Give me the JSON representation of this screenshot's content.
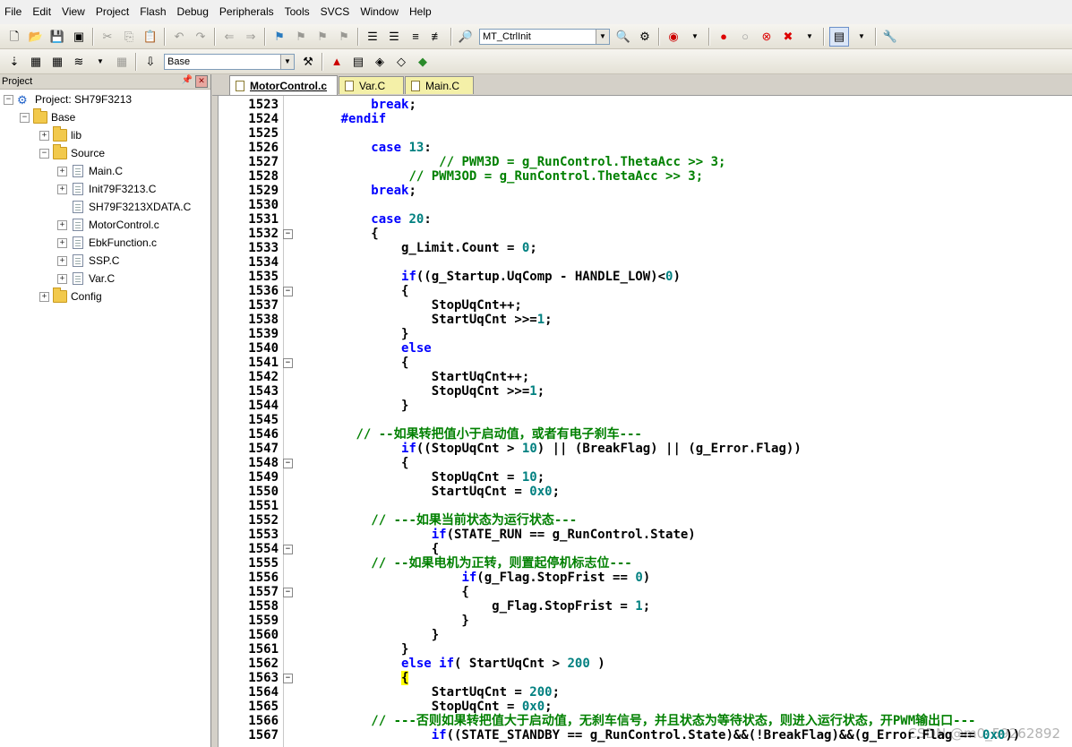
{
  "menu": [
    "File",
    "Edit",
    "View",
    "Project",
    "Flash",
    "Debug",
    "Peripherals",
    "Tools",
    "SVCS",
    "Window",
    "Help"
  ],
  "toolbar1": {
    "function_combo": "MT_CtrlInit"
  },
  "toolbar2": {
    "target_combo": "Base"
  },
  "project_panel": {
    "title": "Project",
    "tree": [
      {
        "label": "Project: SH79F3213",
        "level": 0,
        "type": "project",
        "expander": "−"
      },
      {
        "label": "Base",
        "level": 1,
        "type": "folder",
        "expander": "−"
      },
      {
        "label": "lib",
        "level": 2,
        "type": "folder",
        "expander": "+"
      },
      {
        "label": "Source",
        "level": 2,
        "type": "folder",
        "expander": "−"
      },
      {
        "label": "Main.C",
        "level": 3,
        "type": "file",
        "expander": "+"
      },
      {
        "label": "Init79F3213.C",
        "level": 3,
        "type": "file",
        "expander": "+"
      },
      {
        "label": "SH79F3213XDATA.C",
        "level": 3,
        "type": "file",
        "expander": ""
      },
      {
        "label": "MotorControl.c",
        "level": 3,
        "type": "file",
        "expander": "+"
      },
      {
        "label": "EbkFunction.c",
        "level": 3,
        "type": "file",
        "expander": "+"
      },
      {
        "label": "SSP.C",
        "level": 3,
        "type": "file",
        "expander": "+"
      },
      {
        "label": "Var.C",
        "level": 3,
        "type": "file",
        "expander": "+"
      },
      {
        "label": "Config",
        "level": 2,
        "type": "folder",
        "expander": "+"
      }
    ]
  },
  "tabs": [
    {
      "label": "MotorControl.c",
      "active": true
    },
    {
      "label": "Var.C",
      "active": false
    },
    {
      "label": "Main.C",
      "active": false
    }
  ],
  "code_lines": [
    {
      "n": "1523",
      "fold": "",
      "html": "          <span class='kw'>break</span>;"
    },
    {
      "n": "1524",
      "fold": "",
      "html": "      <span class='pp'>#endif</span>"
    },
    {
      "n": "1525",
      "fold": "",
      "html": ""
    },
    {
      "n": "1526",
      "fold": "",
      "html": "          <span class='kw'>case</span> <span class='num'>13</span>:"
    },
    {
      "n": "1527",
      "fold": "",
      "html": "                   <span class='cm'>// PWM3D = g_RunControl.ThetaAcc &gt;&gt; 3;</span>"
    },
    {
      "n": "1528",
      "fold": "",
      "html": "               <span class='cm'>// PWM3OD = g_RunControl.ThetaAcc &gt;&gt; 3;</span>"
    },
    {
      "n": "1529",
      "fold": "",
      "html": "          <span class='kw'>break</span>;"
    },
    {
      "n": "1530",
      "fold": "",
      "html": ""
    },
    {
      "n": "1531",
      "fold": "",
      "html": "          <span class='kw'>case</span> <span class='num'>20</span>:"
    },
    {
      "n": "1532",
      "fold": "−",
      "html": "          {"
    },
    {
      "n": "1533",
      "fold": "",
      "html": "              g_Limit.Count = <span class='num'>0</span>;"
    },
    {
      "n": "1534",
      "fold": "",
      "html": ""
    },
    {
      "n": "1535",
      "fold": "",
      "html": "              <span class='kw'>if</span>((g_Startup.UqComp - HANDLE_LOW)&lt;<span class='num'>0</span>)"
    },
    {
      "n": "1536",
      "fold": "−",
      "html": "              {"
    },
    {
      "n": "1537",
      "fold": "",
      "html": "                  StopUqCnt++;"
    },
    {
      "n": "1538",
      "fold": "",
      "html": "                  StartUqCnt &gt;&gt;=<span class='num'>1</span>;"
    },
    {
      "n": "1539",
      "fold": "",
      "html": "              }"
    },
    {
      "n": "1540",
      "fold": "",
      "html": "              <span class='kw'>else</span>"
    },
    {
      "n": "1541",
      "fold": "−",
      "html": "              {"
    },
    {
      "n": "1542",
      "fold": "",
      "html": "                  StartUqCnt++;"
    },
    {
      "n": "1543",
      "fold": "",
      "html": "                  StopUqCnt &gt;&gt;=<span class='num'>1</span>;"
    },
    {
      "n": "1544",
      "fold": "",
      "html": "              }"
    },
    {
      "n": "1545",
      "fold": "",
      "html": ""
    },
    {
      "n": "1546",
      "fold": "",
      "html": "        <span class='cm'>// --如果转把值小于启动值，或者有电子刹车---</span>"
    },
    {
      "n": "1547",
      "fold": "",
      "html": "              <span class='kw'>if</span>((StopUqCnt &gt; <span class='num'>10</span>) || (BreakFlag) || (g_Error.Flag))"
    },
    {
      "n": "1548",
      "fold": "−",
      "html": "              {"
    },
    {
      "n": "1549",
      "fold": "",
      "html": "                  StopUqCnt = <span class='num'>10</span>;"
    },
    {
      "n": "1550",
      "fold": "",
      "html": "                  StartUqCnt = <span class='num'>0x0</span>;"
    },
    {
      "n": "1551",
      "fold": "",
      "html": ""
    },
    {
      "n": "1552",
      "fold": "",
      "html": "          <span class='cm'>// ---如果当前状态为运行状态---</span>"
    },
    {
      "n": "1553",
      "fold": "",
      "html": "                  <span class='kw'>if</span>(STATE_RUN == g_RunControl.State)"
    },
    {
      "n": "1554",
      "fold": "−",
      "html": "                  {"
    },
    {
      "n": "1555",
      "fold": "",
      "html": "          <span class='cm'>// --如果电机为正转，则置起停机标志位---</span>"
    },
    {
      "n": "1556",
      "fold": "",
      "html": "                      <span class='kw'>if</span>(g_Flag.StopFrist == <span class='num'>0</span>)"
    },
    {
      "n": "1557",
      "fold": "−",
      "html": "                      {"
    },
    {
      "n": "1558",
      "fold": "",
      "html": "                          g_Flag.StopFrist = <span class='num'>1</span>;"
    },
    {
      "n": "1559",
      "fold": "",
      "html": "                      }"
    },
    {
      "n": "1560",
      "fold": "",
      "html": "                  }"
    },
    {
      "n": "1561",
      "fold": "",
      "html": "              }"
    },
    {
      "n": "1562",
      "fold": "",
      "html": "              <span class='kw'>else</span> <span class='kw'>if</span>( StartUqCnt &gt; <span class='num'>200</span> )"
    },
    {
      "n": "1563",
      "fold": "−",
      "html": "              <span class='hl'>{</span>"
    },
    {
      "n": "1564",
      "fold": "",
      "html": "                  StartUqCnt = <span class='num'>200</span>;"
    },
    {
      "n": "1565",
      "fold": "",
      "html": "                  StopUqCnt = <span class='num'>0x0</span>;"
    },
    {
      "n": "1566",
      "fold": "",
      "html": "          <span class='cm'>// ---否则如果转把值大于启动值，无刹车信号，并且状态为等待状态，则进入运行状态，开PWM输出口---</span>"
    },
    {
      "n": "1567",
      "fold": "",
      "html": "                  <span class='kw'>if</span>((STATE_STANDBY == g_RunControl.State)&amp;&amp;(!BreakFlag)&amp;&amp;(g_Error.Flag == <span class='num'>0x0</span>))"
    }
  ],
  "watermark": "CSDN @m0_59262892"
}
